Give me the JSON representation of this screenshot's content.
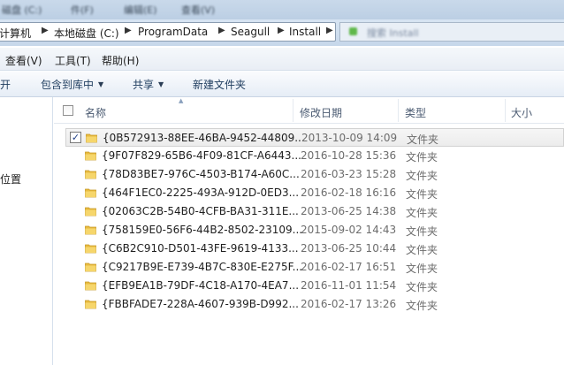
{
  "titlebar": {
    "blurred_1": "磁盘 (C:)",
    "blurred_2": "件(F)",
    "blurred_3": "编辑(E)",
    "blurred_4": "查看(V)"
  },
  "address": {
    "crumbs": [
      "计算机",
      "本地磁盘 (C:)",
      "ProgramData",
      "Seagull",
      "Install"
    ],
    "search_placeholder": "搜索 Install"
  },
  "menu": {
    "items": [
      "查看(V)",
      "工具(T)",
      "帮助(H)"
    ]
  },
  "commands": {
    "open": "打开",
    "include_library": "包含到库中",
    "share": "共享",
    "new_folder": "新建文件夹"
  },
  "nav": {
    "item": "位置"
  },
  "columns": {
    "name": "名称",
    "modified": "修改日期",
    "type": "类型",
    "size": "大小"
  },
  "files": [
    {
      "name": "{0B572913-88EE-46BA-9452-44809...",
      "modified": "2013-10-09 14:09",
      "type": "文件夹",
      "checked": true
    },
    {
      "name": "{9F07F829-65B6-4F09-81CF-A6443...",
      "modified": "2016-10-28 15:36",
      "type": "文件夹",
      "checked": false
    },
    {
      "name": "{78D83BE7-976C-4503-B174-A60C...",
      "modified": "2016-03-23 15:28",
      "type": "文件夹",
      "checked": false
    },
    {
      "name": "{464F1EC0-2225-493A-912D-0ED3...",
      "modified": "2016-02-18 16:16",
      "type": "文件夹",
      "checked": false
    },
    {
      "name": "{02063C2B-54B0-4CFB-BA31-311E...",
      "modified": "2013-06-25 14:38",
      "type": "文件夹",
      "checked": false
    },
    {
      "name": "{758159E0-56F6-44B2-8502-23109...",
      "modified": "2015-09-02 14:43",
      "type": "文件夹",
      "checked": false
    },
    {
      "name": "{C6B2C910-D501-43FE-9619-4133...",
      "modified": "2013-06-25 10:44",
      "type": "文件夹",
      "checked": false
    },
    {
      "name": "{C9217B9E-E739-4B7C-830E-E275F...",
      "modified": "2016-02-17 16:51",
      "type": "文件夹",
      "checked": false
    },
    {
      "name": "{EFB9EA1B-79DF-4C18-A170-4EA7...",
      "modified": "2016-11-01 11:54",
      "type": "文件夹",
      "checked": false
    },
    {
      "name": "{FBBFADE7-228A-4607-939B-D992...",
      "modified": "2016-02-17 13:26",
      "type": "文件夹",
      "checked": false
    }
  ],
  "colors": {
    "folder_yellow": "#f4cf5d",
    "selection_gray": "#ececec",
    "link_blue": "#1e3c5e"
  }
}
